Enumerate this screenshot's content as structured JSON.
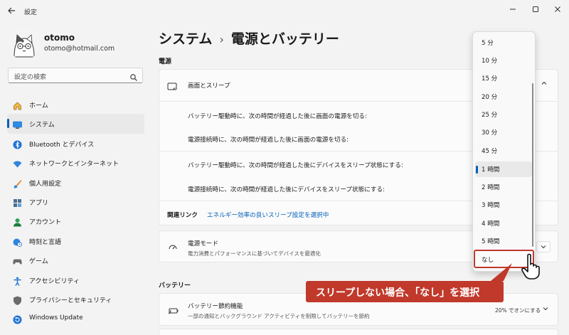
{
  "window": {
    "title": "設定",
    "back_icon": "back-arrow-icon",
    "controls": [
      "minimize-icon",
      "maximize-icon",
      "close-icon"
    ]
  },
  "user": {
    "name": "otomo",
    "email": "otomo@hotmail.com"
  },
  "search": {
    "placeholder": "設定の検索"
  },
  "sidebar": {
    "items": [
      {
        "label": "ホーム",
        "icon": "home-icon",
        "active": false
      },
      {
        "label": "システム",
        "icon": "display-icon",
        "active": true
      },
      {
        "label": "Bluetooth とデバイス",
        "icon": "bluetooth-icon",
        "active": false
      },
      {
        "label": "ネットワークとインターネット",
        "icon": "wifi-icon",
        "active": false
      },
      {
        "label": "個人用設定",
        "icon": "brush-icon",
        "active": false
      },
      {
        "label": "アプリ",
        "icon": "apps-icon",
        "active": false
      },
      {
        "label": "アカウント",
        "icon": "account-icon",
        "active": false
      },
      {
        "label": "時刻と言語",
        "icon": "globe-clock-icon",
        "active": false
      },
      {
        "label": "ゲーム",
        "icon": "gamepad-icon",
        "active": false
      },
      {
        "label": "アクセシビリティ",
        "icon": "accessibility-icon",
        "active": false
      },
      {
        "label": "プライバシーとセキュリティ",
        "icon": "shield-icon",
        "active": false
      },
      {
        "label": "Windows Update",
        "icon": "update-icon",
        "active": false
      }
    ]
  },
  "breadcrumb": {
    "parent": "システム",
    "separator": "›",
    "current": "電源とバッテリー"
  },
  "power": {
    "section_label": "電源",
    "screen_sleep": {
      "title": "画面とスリープ",
      "rows": [
        "バッテリー駆動時に、次の時間が経過した後に画面の電源を切る:",
        "電源接続時に、次の時間が経過した後に画面の電源を切る:",
        "バッテリー駆動時に、次の時間が経過した後にデバイスをスリープ状態にする:",
        "電源接続時に、次の時間が経過した後にデバイスをスリープ状態にする:"
      ],
      "related_label": "関連リンク",
      "related_link": "エネルギー効率の良いスリープ設定を選択中"
    },
    "power_mode": {
      "title": "電源モード",
      "subtitle": "電力消費とパフォーマンスに基づいてデバイスを最適化"
    }
  },
  "battery": {
    "section_label": "バッテリー",
    "saver": {
      "title": "バッテリー節約機能",
      "subtitle": "一部の通知とバックグラウンド アクティビティを制限してバッテリーを節約",
      "value": "20% でオンにする"
    }
  },
  "dropdown": {
    "options": [
      "5 分",
      "10 分",
      "15 分",
      "20 分",
      "25 分",
      "30 分",
      "45 分",
      "1 時間",
      "2 時間",
      "3 時間",
      "4 時間",
      "5 時間",
      "なし"
    ],
    "selected_index": 7,
    "highlighted_index": 12
  },
  "callout": {
    "text": "スリープしない場合、「なし」を選択"
  },
  "colors": {
    "accent": "#005fb8",
    "callout": "#c0392b",
    "link": "#0060b8"
  }
}
